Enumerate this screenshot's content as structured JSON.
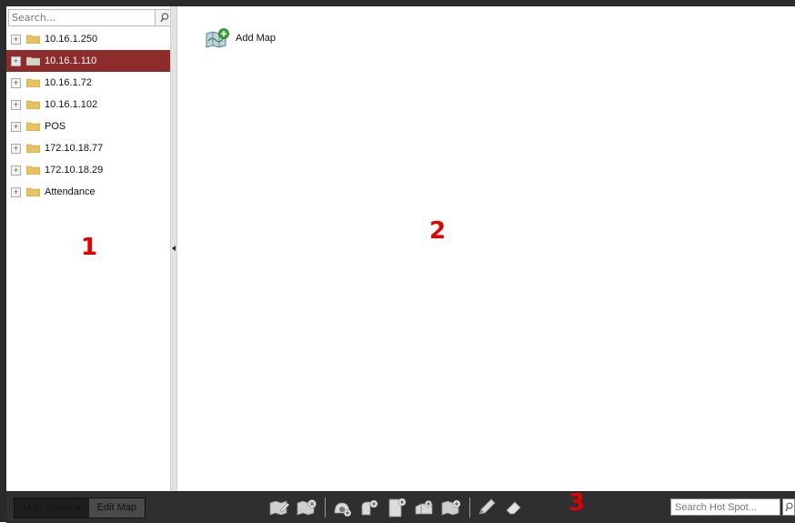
{
  "sidebar": {
    "search_placeholder": "Search...",
    "items": [
      {
        "label": "10.16.1.250"
      },
      {
        "label": "10.16.1.110",
        "selected": true
      },
      {
        "label": "10.16.1.72"
      },
      {
        "label": "10.16.1.102"
      },
      {
        "label": "POS"
      },
      {
        "label": "172.10.18.77"
      },
      {
        "label": "172.10.18.29"
      },
      {
        "label": "Attendance"
      }
    ],
    "expander_glyph": "+",
    "area_number": "1"
  },
  "main": {
    "add_map_label": "Add Map",
    "area_number": "2"
  },
  "toolbar": {
    "tab_preview": "Map Preview",
    "tab_edit": "Edit Map",
    "area_number": "3",
    "hot_spot_placeholder": "Search Hot Spot...",
    "tools": [
      "modify-map-icon",
      "delete-map-icon",
      "add-camera-icon",
      "add-alarm-input-icon",
      "add-door-icon",
      "add-alarm-output-icon",
      "add-hot-region-icon",
      "pencil-icon",
      "eraser-icon"
    ]
  },
  "colors": {
    "selected_row": "#8e2b2b",
    "area_number": "#e00000",
    "toolbar_bg": "#2f2f2f",
    "folder": "#e8c260"
  }
}
